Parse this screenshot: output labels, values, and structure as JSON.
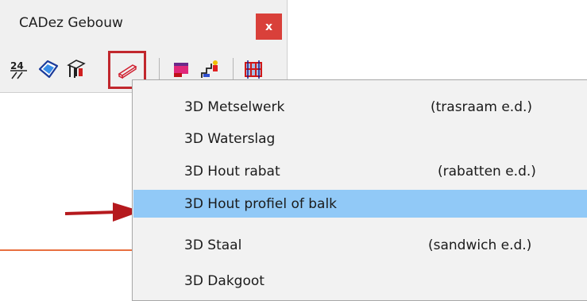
{
  "window": {
    "title": "CADez Gebouw",
    "close_label": "x"
  },
  "toolbar": {
    "tools": [
      {
        "name": "dimension-24-icon"
      },
      {
        "name": "cushion-icon"
      },
      {
        "name": "frame-tool-icon"
      },
      {
        "name": "profile-beam-icon",
        "highlighted": true
      },
      {
        "name": "pink-block-icon"
      },
      {
        "name": "stair-person-icon"
      },
      {
        "name": "grid-frame-icon"
      }
    ]
  },
  "menu": {
    "items": [
      {
        "label": "3D Metselwerk",
        "hint": "(trasraam e.d.)"
      },
      {
        "label": "3D Waterslag",
        "hint": ""
      },
      {
        "label": "3D Hout rabat",
        "hint": "(rabatten e.d.)"
      },
      {
        "label": "3D Hout profiel of balk",
        "hint": "",
        "selected": true
      },
      {
        "label": "3D Staal",
        "hint": "(sandwich e.d.)"
      },
      {
        "label": "3D Dakgoot",
        "hint": ""
      }
    ]
  },
  "colors": {
    "highlight_box": "#c1272d",
    "selection": "#91c9f7",
    "close_button": "#d9403a",
    "arrow": "#b5191d"
  }
}
